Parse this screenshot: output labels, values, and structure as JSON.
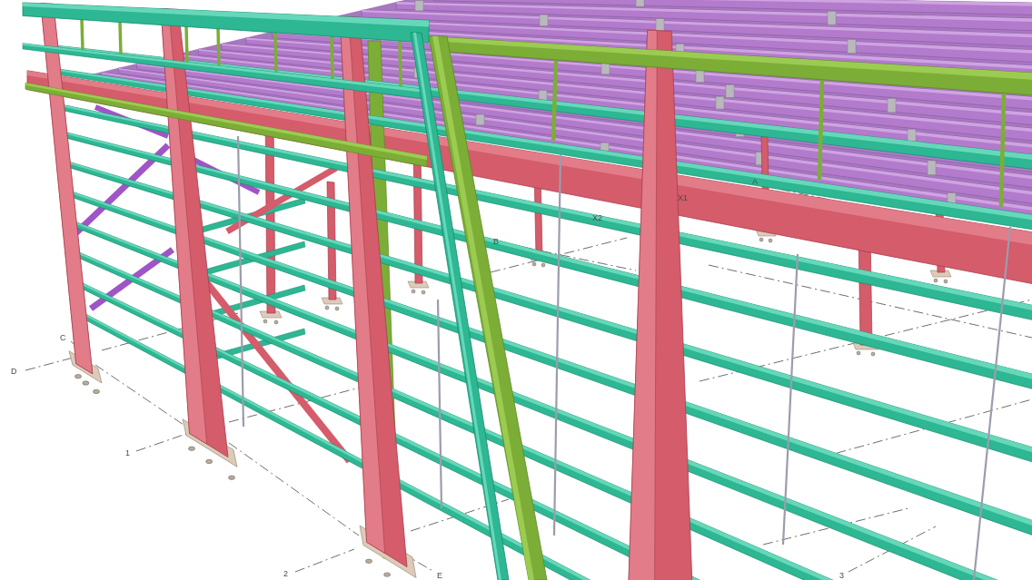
{
  "model_view": {
    "grid_labels": [
      "D",
      "C",
      "1",
      "2",
      "E",
      "B",
      "X2",
      "X1",
      "A",
      "3"
    ]
  }
}
